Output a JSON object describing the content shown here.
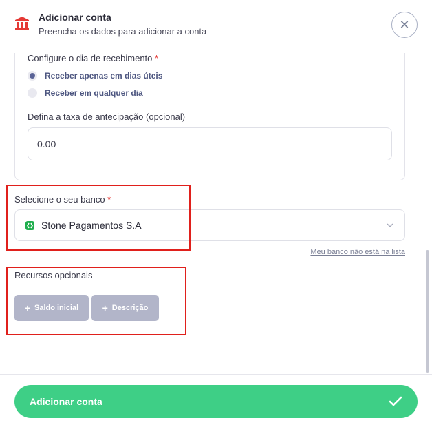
{
  "header": {
    "title": "Adicionar conta",
    "subtitle": "Preencha os dados para adicionar a conta",
    "close_label": "✕"
  },
  "receipt": {
    "label": "Configure o dia de recebimento",
    "required_mark": "*",
    "options": [
      {
        "label": "Receber apenas em dias úteis",
        "selected": true
      },
      {
        "label": "Receber em qualquer dia",
        "selected": false
      }
    ]
  },
  "anticipation": {
    "label": "Defina a taxa de antecipação (opcional)",
    "value": "0.00"
  },
  "bank": {
    "label": "Selecione o seu banco",
    "required_mark": "*",
    "selected": "Stone Pagamentos S.A",
    "missing_link": "Meu banco não está na lista"
  },
  "optional": {
    "label": "Recursos opcionais",
    "buttons": [
      {
        "label": "Saldo inicial"
      },
      {
        "label": "Descrição"
      }
    ]
  },
  "footer": {
    "submit_label": "Adicionar conta"
  },
  "colors": {
    "accent_green": "#3ecf86",
    "highlight_red": "#e0201c",
    "bank_icon_red": "#e53935",
    "radio_selected": "#5a6396"
  }
}
